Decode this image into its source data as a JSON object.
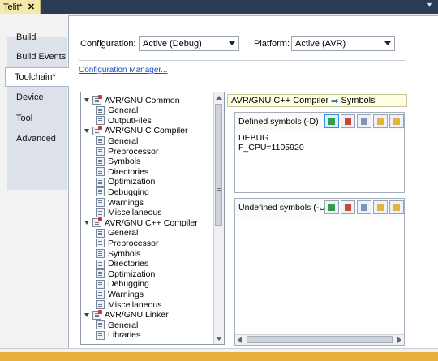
{
  "document_tab": {
    "title": "Telit*",
    "close": "✕"
  },
  "window_controls": "▾",
  "sidebar": {
    "items": [
      {
        "label": "Build"
      },
      {
        "label": "Build Events"
      },
      {
        "label": "Toolchain*"
      },
      {
        "label": "Device"
      },
      {
        "label": "Tool"
      },
      {
        "label": "Advanced"
      }
    ],
    "active_index": 2
  },
  "header": {
    "configuration_label": "Configuration:",
    "configuration_value": "Active (Debug)",
    "platform_label": "Platform:",
    "platform_value": "Active (AVR)",
    "config_manager_link": "Configuration Manager..."
  },
  "tree": {
    "items": [
      {
        "label": "AVR/GNU Common",
        "level": 0
      },
      {
        "label": "General",
        "level": 1
      },
      {
        "label": "OutputFiles",
        "level": 1
      },
      {
        "label": "AVR/GNU C Compiler",
        "level": 0
      },
      {
        "label": "General",
        "level": 1
      },
      {
        "label": "Preprocessor",
        "level": 1
      },
      {
        "label": "Symbols",
        "level": 1
      },
      {
        "label": "Directories",
        "level": 1
      },
      {
        "label": "Optimization",
        "level": 1
      },
      {
        "label": "Debugging",
        "level": 1
      },
      {
        "label": "Warnings",
        "level": 1
      },
      {
        "label": "Miscellaneous",
        "level": 1
      },
      {
        "label": "AVR/GNU C++ Compiler",
        "level": 0
      },
      {
        "label": "General",
        "level": 1
      },
      {
        "label": "Preprocessor",
        "level": 1
      },
      {
        "label": "Symbols",
        "level": 1
      },
      {
        "label": "Directories",
        "level": 1
      },
      {
        "label": "Optimization",
        "level": 1
      },
      {
        "label": "Debugging",
        "level": 1
      },
      {
        "label": "Warnings",
        "level": 1
      },
      {
        "label": "Miscellaneous",
        "level": 1
      },
      {
        "label": "AVR/GNU Linker",
        "level": 0
      },
      {
        "label": "General",
        "level": 1
      },
      {
        "label": "Libraries",
        "level": 1
      }
    ]
  },
  "breadcrumb": {
    "part1": "AVR/GNU C++ Compiler",
    "arrow": "⇒",
    "part2": "Symbols"
  },
  "defined_symbols": {
    "title": "Defined symbols (-D)",
    "values": [
      "DEBUG",
      "F_CPU=1105920"
    ]
  },
  "undefined_symbols": {
    "title": "Undefined symbols (-U)",
    "values": []
  },
  "colors": {
    "accent": "#1a4fc4",
    "tab_bg": "#f5e8a8",
    "chrome": "#2b3a55"
  }
}
